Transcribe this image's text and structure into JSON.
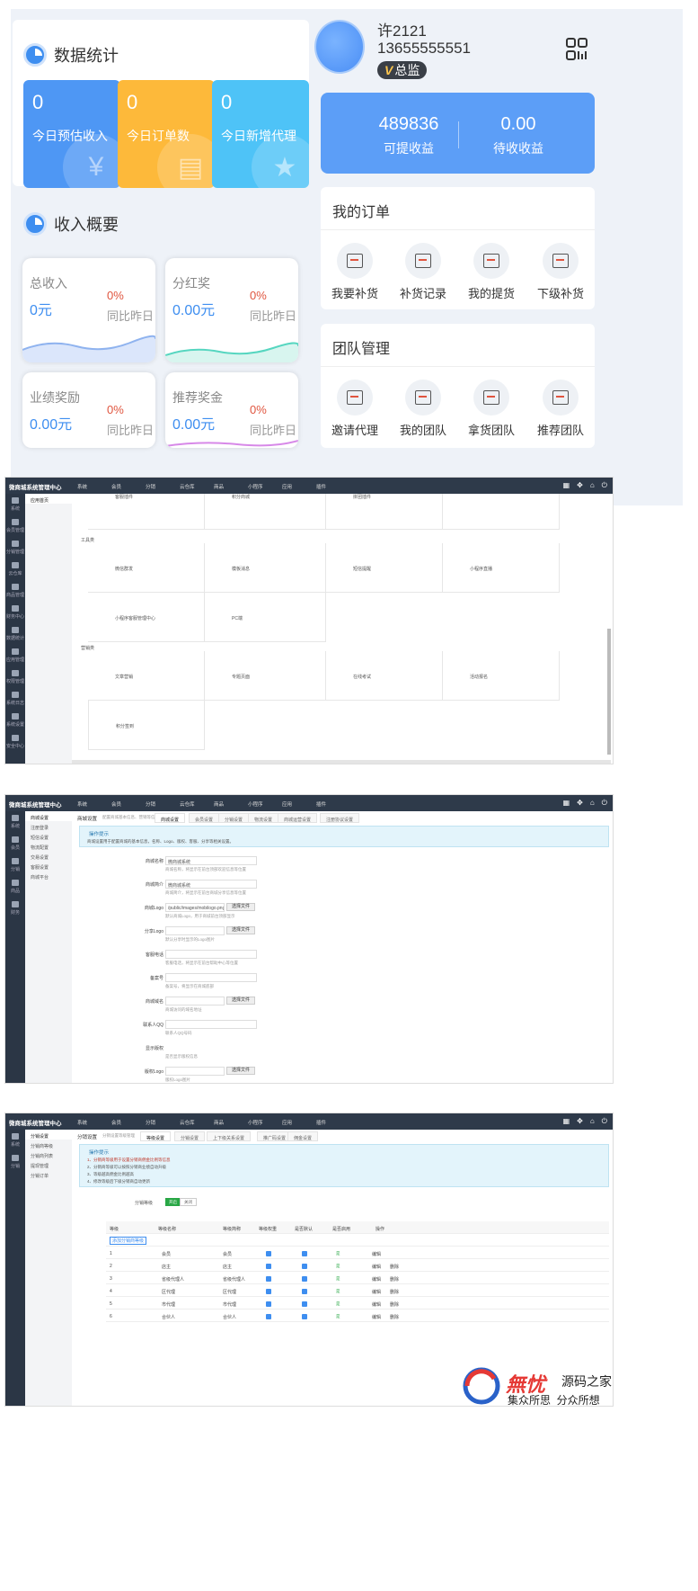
{
  "mobile": {
    "stats_title": "数据统计",
    "stats": [
      {
        "value": "0",
        "label": "今日预估收入",
        "color": "#4e97f4",
        "icon": "yen-icon"
      },
      {
        "value": "0",
        "label": "今日订单数",
        "color": "#fdb93a",
        "icon": "clipboard-icon"
      },
      {
        "value": "0",
        "label": "今日新增代理",
        "color": "#4ec3f7",
        "icon": "star-icon"
      }
    ],
    "user": {
      "name": "许2121",
      "phone": "13655555551",
      "role": "总监",
      "role_badge": "V"
    },
    "balance": {
      "withdrawable": "489836",
      "withdrawable_label": "可提收益",
      "pending": "0.00",
      "pending_label": "待收收益"
    },
    "income_title": "收入概要",
    "income": [
      {
        "title": "总收入",
        "value": "0元",
        "pct": "0%",
        "cmp": "同比昨日",
        "wave": "#8fb3ef"
      },
      {
        "title": "分红奖",
        "value": "0.00元",
        "pct": "0%",
        "cmp": "同比昨日",
        "wave": "#56d6c0"
      },
      {
        "title": "业绩奖励",
        "value": "0.00元",
        "pct": "0%",
        "cmp": "同比昨日",
        "wave": "#8fb3ef"
      },
      {
        "title": "推荐奖金",
        "value": "0.00元",
        "pct": "0%",
        "cmp": "同比昨日",
        "wave": "#d789e8"
      }
    ],
    "orders_title": "我的订单",
    "orders": [
      "我要补货",
      "补货记录",
      "我的提货",
      "下级补货"
    ],
    "team_title": "团队管理",
    "team": [
      "邀请代理",
      "我的团队",
      "拿货团队",
      "推荐团队"
    ]
  },
  "admin": {
    "brand": "微商城系统管理中心",
    "menu": [
      "系统",
      "会员",
      "分销",
      "云仓库",
      "商品",
      "小程序",
      "应用",
      "插件"
    ],
    "panel2": {
      "sub_active": "应用首页",
      "groups": [
        "工具类",
        "营销类"
      ],
      "row0": [
        "客服插件",
        "积分商城",
        "拼团插件"
      ],
      "row1": [
        "微信群发",
        "模板消息",
        "短信提醒",
        "小程序直播"
      ],
      "row2": [
        "小程序客服管理中心",
        "PC端"
      ],
      "row3": [
        "文章营销",
        "专题页面",
        "在线考试",
        "活动报名"
      ],
      "row4": [
        "积分签到"
      ],
      "side": [
        "系统",
        "会员管理",
        "分销管理",
        "云仓库",
        "商品管理",
        "财务中心",
        "数据统计",
        "应用管理",
        "权限管理",
        "系统日志",
        "系统设置",
        "安全中心"
      ]
    },
    "panel3": {
      "sub": [
        "商城设置",
        "注册登录",
        "短信设置",
        "物流配置",
        "交易设置",
        "客服设置",
        "商城平台"
      ],
      "crumb": "商城设置",
      "crumb_note": "配置商城基本信息、营销等信息等",
      "tabs": [
        "商城设置",
        "会员设置",
        "分销设置",
        "物流设置",
        "商城运营设置",
        "注册协议设置"
      ],
      "tip_title": "操作提示",
      "tip_text": "商城设置用于配置商城的基本信息，名称、Logo、版权、客服、分享等相关设置。",
      "fields": [
        {
          "label": "商城名称",
          "value": "微商城系统",
          "hint": "商城名称，将显示在前台顶部欢迎信息等位置"
        },
        {
          "label": "商城简介",
          "value": "微商城系统",
          "hint": "商城简介，将显示在前台商城分享信息等位置"
        },
        {
          "label": "商城Logo",
          "value": "/public/images/mobilogo.png",
          "hint": "默认商城Logo，用于商城前台顶部显示"
        },
        {
          "label": "分享Logo",
          "value": "",
          "hint": "默认分享时显示的Logo图片"
        },
        {
          "label": "客服电话",
          "value": "",
          "hint": "客服电话，将显示在前台帮助中心等位置"
        },
        {
          "label": "备案号",
          "value": "",
          "hint": "备案号，将显示在商城底部"
        },
        {
          "label": "商城域名",
          "value": "",
          "hint": "商城访问的域名地址"
        },
        {
          "label": "联系人QQ",
          "value": "",
          "hint": "联系人QQ号码"
        },
        {
          "label": "显示版权",
          "value": "",
          "hint": "是否显示版权信息"
        },
        {
          "label": "版权Logo",
          "value": "",
          "hint": "版权Logo图片"
        }
      ],
      "upload_label": "选择文件",
      "side": [
        "系统",
        "会员",
        "分销",
        "商品",
        "财务"
      ]
    },
    "panel4": {
      "sub": [
        "分销设置",
        "分销商等级",
        "分销商列表",
        "提现管理",
        "分销订单"
      ],
      "crumb": "分销设置",
      "crumb_note": "分销设置等级管理",
      "tabs": [
        "等级设置",
        "分销设置",
        "上下级关系设置",
        "推广码设置",
        "佣金设置"
      ],
      "tip_title": "操作提示",
      "tip_lines": [
        "1、分销商等级用于设置分销商佣金比例等信息",
        "2、分销商等级可以按照分销商业绩自动升级",
        "3、等级越高佣金比例越高",
        "4、修改等级后下级分销商自动更新"
      ],
      "switch_label": "分销等级",
      "switch_on": "开启",
      "switch_off": "关闭",
      "add_label": "添加分销商等级",
      "headers": [
        "等级",
        "等级名称",
        "等级简称",
        "等级权重",
        "是否默认",
        "是否启用",
        "操作"
      ],
      "rows": [
        {
          "no": "1",
          "name": "会员",
          "short": "会员"
        },
        {
          "no": "2",
          "name": "店主",
          "short": "店主"
        },
        {
          "no": "3",
          "name": "省级代理人",
          "short": "省级代理人"
        },
        {
          "no": "4",
          "name": "区代理",
          "short": "区代理"
        },
        {
          "no": "5",
          "name": "市代理",
          "short": "市代理"
        },
        {
          "no": "6",
          "name": "合伙人",
          "short": "合伙人"
        }
      ],
      "on_label": "是",
      "edit_label": "编辑",
      "del_label": "删除",
      "side": [
        "系统",
        "分销"
      ]
    }
  },
  "watermark": {
    "brand": "源码之家",
    "slogan": "集众所思  分众所想",
    "logo_text": "無忧"
  }
}
